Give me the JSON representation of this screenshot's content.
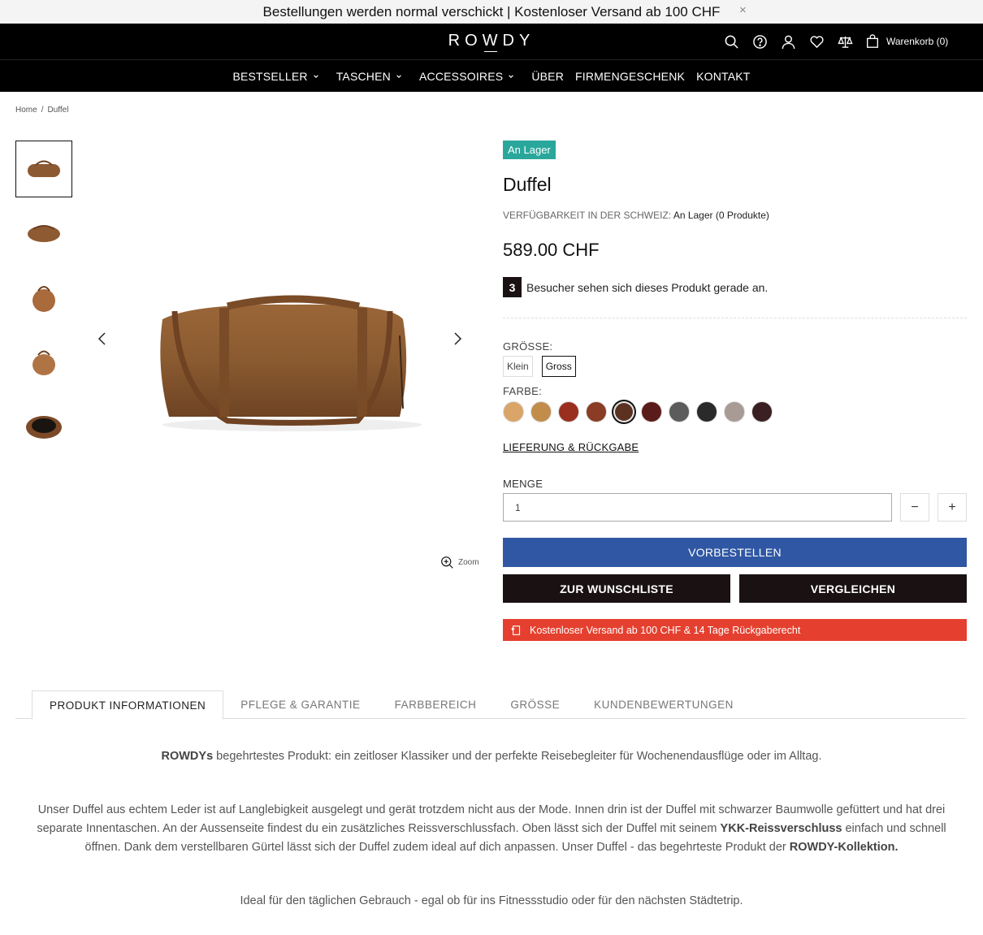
{
  "announcement": {
    "text": "Bestellungen werden normal verschickt | Kostenloser Versand ab 100 CHF",
    "close": "×"
  },
  "header": {
    "logo": "ROWDY",
    "icons": [
      "search-icon",
      "help-icon",
      "account-icon",
      "heart-icon",
      "compare-icon"
    ],
    "cart_label": "Warenkorb (0)"
  },
  "nav": {
    "items": [
      {
        "label": "BESTSELLER",
        "dropdown": true
      },
      {
        "label": "TASCHEN",
        "dropdown": true
      },
      {
        "label": "ACCESSOIRES",
        "dropdown": true
      },
      {
        "label": "ÜBER",
        "dropdown": false
      },
      {
        "label": "FIRMENGESCHENK",
        "dropdown": false
      },
      {
        "label": "KONTAKT",
        "dropdown": false
      }
    ]
  },
  "breadcrumb": {
    "home": "Home",
    "separator": "/",
    "current": "Duffel"
  },
  "gallery": {
    "zoom_label": "Zoom",
    "thumb_count": 5
  },
  "product": {
    "badge": "An Lager",
    "title": "Duffel",
    "availability_label": "VERFÜGBARKEIT IN DER SCHWEIZ:",
    "availability_value": "An Lager (0 Produkte)",
    "price": "589.00 CHF",
    "visitor_count": "3",
    "visitor_text": "Besucher sehen sich dieses Produkt gerade an.",
    "size_label": "GRÖSSE:",
    "sizes": [
      "Klein",
      "Gross"
    ],
    "selected_size": "Gross",
    "color_label": "FARBE:",
    "colors": [
      "#d9a569",
      "#c28c4b",
      "#9b2f1f",
      "#8a3d24",
      "#5b3222",
      "#5a1c1a",
      "#5c5c5c",
      "#2a2a2a",
      "#a89a94",
      "#3a2020"
    ],
    "selected_color_index": 4,
    "delivery_link": "LIEFERUNG & RÜCKGABE",
    "quantity_label": "MENGE",
    "quantity_value": "1",
    "minus": "−",
    "plus": "+",
    "preorder_button": "VORBESTELLEN",
    "wishlist_button": "ZUR WUNSCHLISTE",
    "compare_button": "VERGLEICHEN",
    "shipping_banner": "Kostenloser Versand ab 100 CHF & 14 Tage Rückgaberecht"
  },
  "tabs": [
    "PRODUKT INFORMATIONEN",
    "PFLEGE & GARANTIE",
    "FARBBEREICH",
    "GRÖSSE",
    "KUNDENBEWERTUNGEN"
  ],
  "description": {
    "p1_bold": "ROWDYs",
    "p1_rest": " begehrtestes Produkt: ein zeitloser Klassiker und der perfekte Reisebegleiter für Wochenendausflüge oder im Alltag.",
    "p2_a": "Unser Duffel aus echtem Leder ist auf Langlebigkeit ausgelegt und gerät trotzdem nicht aus der Mode. Innen drin ist der Duffel mit schwarzer Baumwolle gefüttert und hat drei separate Innentaschen. An der Aussenseite findest du ein zusätzliches Reissverschlussfach. Oben lässt sich der Duffel mit seinem ",
    "p2_b": "YKK-Reissverschluss",
    "p2_c": " einfach und schnell öffnen. Dank dem verstellbaren Gürtel lässt sich der Duffel zudem ideal auf dich anpassen. Unser Duffel - das begehrteste Produkt der ",
    "p2_d": "ROWDY-Kollektion.",
    "p3": "Ideal für den täglichen Gebrauch - egal ob für ins Fitnessstudio oder für den nächsten Städtetrip."
  }
}
